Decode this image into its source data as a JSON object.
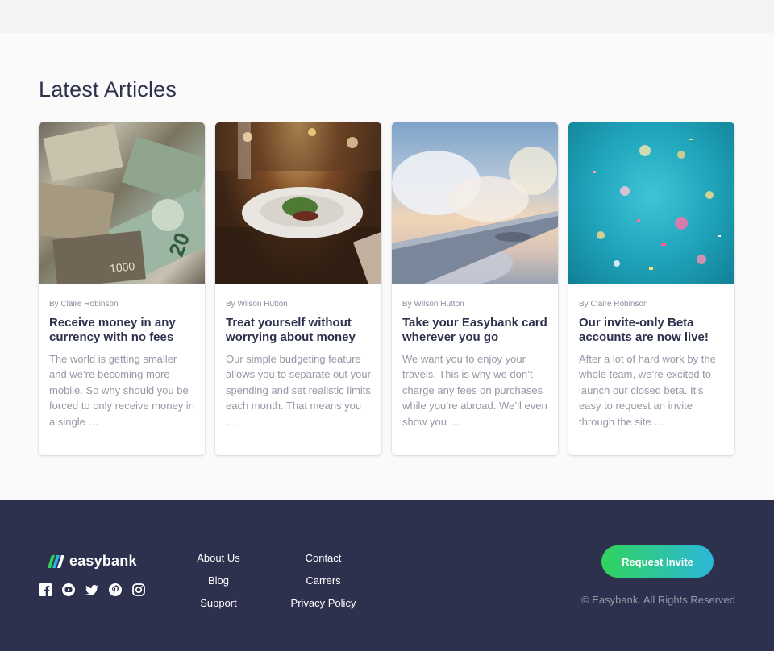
{
  "articles": {
    "heading": "Latest Articles",
    "cards": [
      {
        "image": "money-photo",
        "author": "By Claire Robinson",
        "title": "Receive money in any currency with no fees",
        "description": "The world is getting smaller and we’re becoming more mobile. So why should you be forced to only receive money in a single …"
      },
      {
        "image": "restaurant-photo",
        "author": "By Wilson Hutton",
        "title": "Treat yourself without worrying about money",
        "description": "Our simple budgeting feature allows you to separate out your spending and set realistic limits each month. That means you …"
      },
      {
        "image": "airplane-wing-photo",
        "author": "By Wilson Hutton",
        "title": "Take your Easybank card wherever you go",
        "description": "We want you to enjoy your travels. This is why we don’t charge any fees on purchases while you’re abroad. We’ll even show you …"
      },
      {
        "image": "confetti-photo",
        "author": "By Claire Robinson",
        "title": "Our invite-only Beta accounts are now live!",
        "description": "After a lot of hard work by the whole team, we’re excited to launch our closed beta. It’s easy to request an invite through the site …"
      }
    ]
  },
  "footer": {
    "logo_text": "easybank",
    "socials": [
      "facebook-icon",
      "youtube-icon",
      "twitter-icon",
      "pinterest-icon",
      "instagram-icon"
    ],
    "links_col1": [
      "About Us",
      "Blog",
      "Support"
    ],
    "links_col2": [
      "Contact",
      "Carrers",
      "Privacy Policy"
    ],
    "cta_label": "Request Invite",
    "copyright": "© Easybank. All Rights Reserved"
  },
  "colors": {
    "dark_blue": "#2d314d",
    "lime_green": "#31d35c",
    "bright_cyan": "#2bb7da",
    "grayish_blue": "#9698a6",
    "light_background": "#fafafa"
  }
}
